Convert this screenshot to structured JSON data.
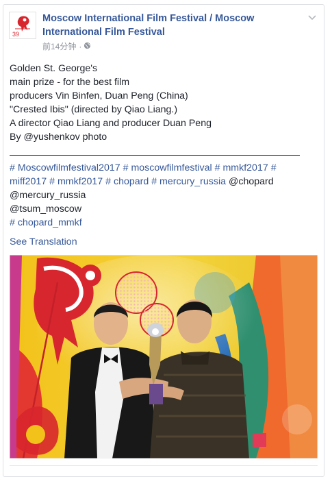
{
  "post": {
    "page_name": "Moscow International Film Festival / Moscow International Film Festival",
    "avatar_badge": "39",
    "time": "前14分钟",
    "separator": "·",
    "privacy_icon": "globe-icon",
    "menu_icon": "chevron-down-icon",
    "body_lines": [
      "Golden St. George's",
      "main prize - for the best film",
      "producers Vin Binfen, Duan Peng (China)",
      "\"Crested Ibis\" (directed by Qiao Liang.)",
      "A director Qiao Liang and producer Duan Peng",
      "By @yushenkov photo"
    ],
    "tags": {
      "l1_t1": "# Moscowfilmfestival2017",
      "l1_t2": "# moscowfilmfestival",
      "l1_t3": "# mmkf2017",
      "l1_t4": "#",
      "l2_t1": "miff2017",
      "l2_t2": "# mmkf2017",
      "l2_t3": "# chopard",
      "l2_t4": "# mercury_russia",
      "l2_plain": "@chopard",
      "l3_plain": "@mercury_russia",
      "l4_plain": "@tsum_moscow",
      "l5_t1": "# chopard_mmkf"
    },
    "see_translation": "See Translation"
  },
  "colors": {
    "link": "#365899",
    "text": "#1d2129",
    "meta": "#90949c",
    "brand_red": "#d7262e"
  }
}
